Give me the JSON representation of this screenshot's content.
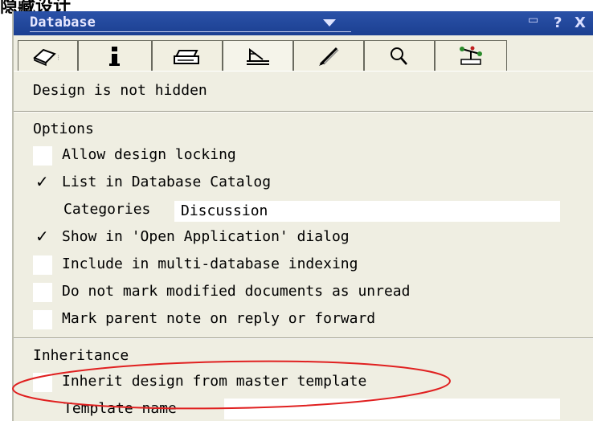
{
  "caption": "隐藏设计",
  "window": {
    "title": "Database",
    "buttons": {
      "minimize": "▭",
      "help": "?",
      "close": "X"
    }
  },
  "tabs": [
    {
      "name": "basics",
      "icon": "eraser-icon"
    },
    {
      "name": "info",
      "icon": "info-icon"
    },
    {
      "name": "printing",
      "icon": "printer-icon"
    },
    {
      "name": "design",
      "icon": "tsquare-icon",
      "active": true
    },
    {
      "name": "launch",
      "icon": "rocket-icon"
    },
    {
      "name": "fulltext",
      "icon": "magnifier-icon"
    },
    {
      "name": "advanced",
      "icon": "propeller-icon"
    }
  ],
  "design_status": "Design is not hidden",
  "options": {
    "heading": "Options",
    "allow_design_locking": {
      "label": "Allow design locking",
      "checked": false
    },
    "list_in_catalog": {
      "label": "List in Database Catalog",
      "checked": true
    },
    "categories": {
      "label": "Categories",
      "value": "Discussion"
    },
    "show_in_open_dialog": {
      "label": "Show in 'Open Application' dialog",
      "checked": true
    },
    "multi_db_indexing": {
      "label": "Include in multi-database indexing",
      "checked": false
    },
    "do_not_mark_unread": {
      "label": "Do not mark modified documents as unread",
      "checked": false
    },
    "mark_parent_note": {
      "label": "Mark parent note on reply or forward",
      "checked": false
    }
  },
  "inheritance": {
    "heading": "Inheritance",
    "inherit_design": {
      "label": "Inherit design from master template",
      "checked": false
    },
    "template_name": {
      "label": "Template name",
      "value": ""
    }
  },
  "colors": {
    "titlebar": "#1b3f91",
    "panel": "#efeee2",
    "highlight_ellipse": "#e02020"
  }
}
